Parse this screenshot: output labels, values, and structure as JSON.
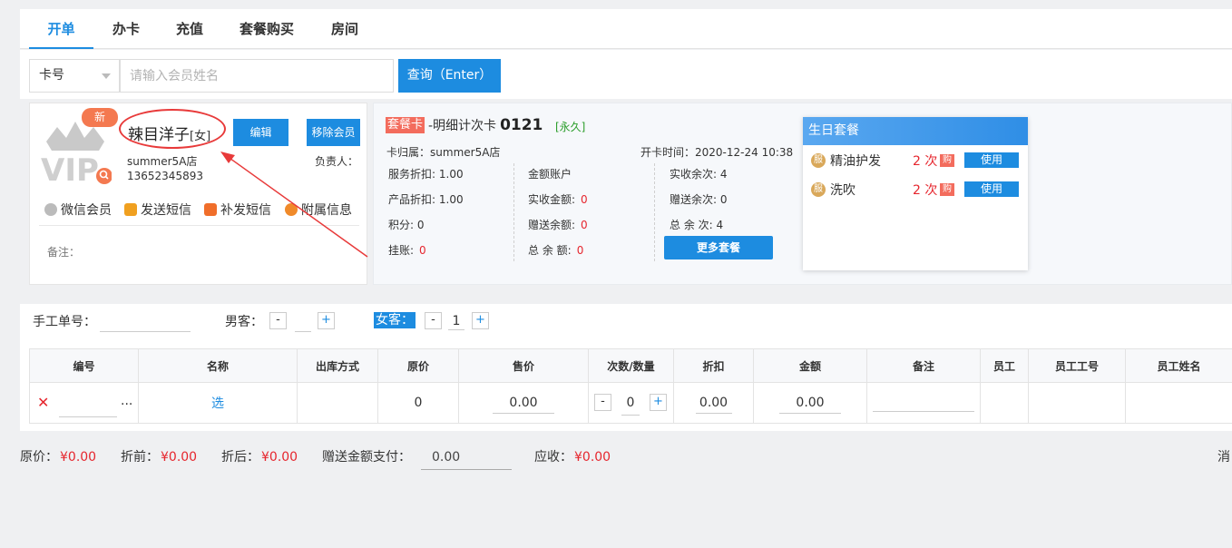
{
  "tabs": [
    {
      "label": "开单",
      "active": true
    },
    {
      "label": "办卡",
      "active": false
    },
    {
      "label": "充值",
      "active": false
    },
    {
      "label": "套餐购买",
      "active": false
    },
    {
      "label": "房间",
      "active": false
    }
  ],
  "search": {
    "select_value": "卡号",
    "placeholder": "请输入会员姓名",
    "query_label": "查询（Enter）"
  },
  "member": {
    "badge": "新",
    "name": "辣目洋子",
    "gender": "[女]",
    "edit_label": "编辑",
    "remove_label": "移除会员",
    "store": "summer5A店",
    "phone": "13652345893",
    "owner_label": "负责人：",
    "actions": {
      "wechat": "微信会员",
      "sms": "发送短信",
      "resend": "补发短信",
      "extra": "附属信息"
    },
    "remark_label": "备注："
  },
  "package": {
    "tag": "套餐卡",
    "name": "-明细计次卡",
    "code": "0121",
    "validity": "[永久]",
    "store_label": "卡归属：",
    "store": "summer5A店",
    "open_time_label": "开卡时间：",
    "open_time": "2020-12-24 10:38",
    "service_discount_label": "服务折扣:",
    "service_discount": "1.00",
    "product_discount_label": "产品折扣:",
    "product_discount": "1.00",
    "points_label": "积分:",
    "points": "0",
    "credit_label": "挂账:",
    "credit": "0",
    "amount_account_label": "金额账户",
    "actual_balance_label": "实收金额:",
    "actual_balance": "0",
    "gift_balance_label": "赠送余额:",
    "gift_balance": "0",
    "total_balance_label": "总 余 额:",
    "total_balance": "0",
    "actual_times_label": "实收余次:",
    "actual_times": "4",
    "gift_times_label": "赠送余次:",
    "gift_times": "0",
    "total_times_label": "总 余 次:",
    "total_times": "4",
    "more_label": "更多套餐"
  },
  "birthday": {
    "title": "生日套餐",
    "items": [
      {
        "icon": "服",
        "name": "精油护发",
        "count": "2 次",
        "buy": "购",
        "use": "使用"
      },
      {
        "icon": "服",
        "name": "洗吹",
        "count": "2 次",
        "buy": "购",
        "use": "使用"
      }
    ]
  },
  "order": {
    "manual_no_label": "手工单号：",
    "male_label": "男客：",
    "male_minus": "-",
    "male_count": "",
    "male_plus": "+",
    "female_label": "女客：",
    "female_minus": "-",
    "female_count": "1",
    "female_plus": "+"
  },
  "table": {
    "headers": [
      "编号",
      "名称",
      "出库方式",
      "原价",
      "售价",
      "次数/数量",
      "折扣",
      "金额",
      "备注",
      "员工",
      "员工工号",
      "员工姓名"
    ],
    "row": {
      "delete_icon": "✕",
      "more": "...",
      "name": "选",
      "method": "",
      "orig_price": "0",
      "sale_price": "0.00",
      "qty_minus": "-",
      "qty": "0",
      "qty_plus": "+",
      "discount": "0.00",
      "amount": "0.00"
    }
  },
  "footer": {
    "orig_label": "原价：",
    "orig": "¥0.00",
    "before_label": "折前：",
    "before": "¥0.00",
    "after_label": "折后：",
    "after": "¥0.00",
    "gift_pay_label": "赠送金额支付：",
    "gift_pay": "0.00",
    "due_label": "应收：",
    "due": "¥0.00",
    "right_cut": "消"
  },
  "colors": {
    "accent": "#1d8ce0",
    "red": "#e6262e",
    "tag": "#f36c5d"
  }
}
